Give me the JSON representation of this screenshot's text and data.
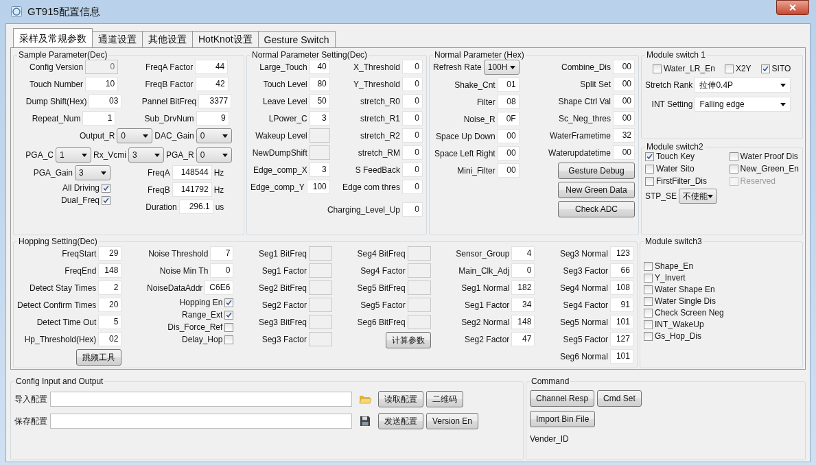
{
  "window": {
    "title": "GT915配置信息"
  },
  "tabs": [
    {
      "label": "采样及常规参数",
      "selected": true
    },
    {
      "label": "通道设置",
      "selected": false
    },
    {
      "label": "其他设置",
      "selected": false
    },
    {
      "label": "HotKnot设置",
      "selected": false
    },
    {
      "label": "Gesture Switch",
      "selected": false
    }
  ],
  "top_row": [
    {
      "title": "Sample Parameter(Dec)",
      "blocks": [
        {
          "columns": [
            [
              [
                {
                  "kind": "field",
                  "label": "Config Version",
                  "value": "0",
                  "disabled": true
                }
              ],
              [
                {
                  "kind": "field",
                  "label": "Touch Number",
                  "value": "10"
                }
              ],
              [
                {
                  "kind": "field",
                  "label": "Dump Shift(Hex)",
                  "value": "03"
                }
              ],
              [
                {
                  "kind": "field",
                  "label": "Repeat_Num",
                  "value": "1"
                }
              ]
            ],
            [
              [
                {
                  "kind": "field",
                  "label": "FreqA Factor",
                  "value": "44"
                }
              ],
              [
                {
                  "kind": "field",
                  "label": "FreqB Factor",
                  "value": "42"
                }
              ],
              [
                {
                  "kind": "field",
                  "label": "Pannel BitFreq",
                  "value": "3377"
                }
              ],
              [
                {
                  "kind": "field",
                  "label": "Sub_DrvNum",
                  "value": "9"
                }
              ]
            ]
          ]
        },
        {
          "columns": [
            [
              [
                {
                  "kind": "select",
                  "label": "Output_R",
                  "value": "0"
                },
                {
                  "kind": "select",
                  "label": "DAC_Gain",
                  "value": "0"
                }
              ],
              [
                {
                  "kind": "select",
                  "label": "PGA_C",
                  "value": "1"
                },
                {
                  "kind": "select",
                  "label": "Rx_Vcmi",
                  "value": "3"
                },
                {
                  "kind": "select",
                  "label": "PGA_R",
                  "value": "0"
                }
              ]
            ]
          ]
        },
        {
          "columns": [
            [
              [
                {
                  "kind": "select",
                  "label": "PGA_Gain",
                  "value": "3"
                }
              ],
              [
                {
                  "kind": "toggle",
                  "label": "All Driving",
                  "checked": true
                }
              ],
              [
                {
                  "kind": "toggle",
                  "label": "Dual_Freq",
                  "checked": true
                }
              ]
            ],
            [
              [
                {
                  "kind": "field",
                  "label": "FreqA",
                  "value": "148544",
                  "unit": "Hz"
                }
              ],
              [
                {
                  "kind": "field",
                  "label": "FreqB",
                  "value": "141792",
                  "unit": "Hz"
                }
              ],
              [
                {
                  "kind": "field",
                  "label": "Duration",
                  "value": "296.1",
                  "unit": "us"
                }
              ]
            ]
          ]
        }
      ]
    },
    {
      "title": "Normal Parameter Setting(Dec)",
      "blocks": [
        {
          "columns": [
            [
              [
                {
                  "kind": "field",
                  "label": "Large_Touch",
                  "value": "40"
                }
              ],
              [
                {
                  "kind": "field",
                  "label": "Touch Level",
                  "value": "80"
                }
              ],
              [
                {
                  "kind": "field",
                  "label": "Leave Level",
                  "value": "50"
                }
              ],
              [
                {
                  "kind": "field",
                  "label": "LPower_C",
                  "value": "3"
                }
              ],
              [
                {
                  "kind": "field",
                  "label": "Wakeup Level",
                  "disabled": true
                }
              ],
              [
                {
                  "kind": "field",
                  "label": "NewDumpShift",
                  "disabled": true
                }
              ],
              [
                {
                  "kind": "field",
                  "label": "Edge_comp_X",
                  "value": "3"
                }
              ],
              [
                {
                  "kind": "field",
                  "label": "Edge_comp_Y",
                  "value": "100"
                }
              ]
            ],
            [
              [
                {
                  "kind": "field",
                  "label": "X_Threshold",
                  "value": "0"
                }
              ],
              [
                {
                  "kind": "field",
                  "label": "Y_Threshold",
                  "value": "0"
                }
              ],
              [
                {
                  "kind": "field",
                  "label": "stretch_R0",
                  "value": "0"
                }
              ],
              [
                {
                  "kind": "field",
                  "label": "stretch_R1",
                  "value": "0"
                }
              ],
              [
                {
                  "kind": "field",
                  "label": "stretch_R2",
                  "value": "0"
                }
              ],
              [
                {
                  "kind": "field",
                  "label": "stretch_RM",
                  "value": "0"
                }
              ],
              [
                {
                  "kind": "field",
                  "label": "S  FeedBack",
                  "value": "0"
                }
              ],
              [
                {
                  "kind": "field",
                  "label": "Edge com thres",
                  "value": "0"
                }
              ]
            ]
          ]
        },
        {
          "columns": [
            [
              [
                {
                  "kind": "field",
                  "label": "Charging_Level_Up",
                  "value": "0"
                }
              ]
            ]
          ]
        }
      ]
    },
    {
      "title": "Normal Parameter (Hex)",
      "blocks": [
        {
          "columns": [
            [
              [
                {
                  "kind": "select",
                  "label": "Refresh Rate",
                  "value": "100H"
                }
              ],
              [
                {
                  "kind": "field",
                  "label": "Shake_Cnt",
                  "value": "01"
                }
              ],
              [
                {
                  "kind": "field",
                  "label": "Filter",
                  "value": "08"
                }
              ],
              [
                {
                  "kind": "field",
                  "label": "Noise_R",
                  "value": "0F"
                }
              ],
              [
                {
                  "kind": "field",
                  "label": "Space Up Down",
                  "value": "00"
                }
              ],
              [
                {
                  "kind": "field",
                  "label": "Space Left Right",
                  "value": "00"
                }
              ],
              [
                {
                  "kind": "field",
                  "label": "Mini_Filter",
                  "value": "00"
                }
              ]
            ],
            [
              [
                {
                  "kind": "field",
                  "label": "Combine_Dis",
                  "value": "00"
                }
              ],
              [
                {
                  "kind": "field",
                  "label": "Split Set",
                  "value": "00"
                }
              ],
              [
                {
                  "kind": "field",
                  "label": "Shape Ctrl Val",
                  "value": "00"
                }
              ],
              [
                {
                  "kind": "field",
                  "label": "Sc_Neg_thres",
                  "value": "00"
                }
              ],
              [
                {
                  "kind": "field",
                  "label": "WaterFrametime",
                  "value": "32"
                }
              ],
              [
                {
                  "kind": "field",
                  "label": "Waterupdatetime",
                  "value": "00"
                }
              ],
              [
                {
                  "kind": "button",
                  "label": "Gesture Debug"
                }
              ],
              [
                {
                  "kind": "button",
                  "label": "New Green Data"
                }
              ],
              [
                {
                  "kind": "button",
                  "label": "Check ADC"
                }
              ]
            ]
          ]
        }
      ]
    }
  ],
  "side_stack": [
    {
      "title": "Module switch 1",
      "blocks": [
        {
          "columns": [
            [
              [
                {
                  "kind": "check",
                  "label": "Water_LR_En",
                  "checked": false
                },
                {
                  "kind": "check",
                  "label": "X2Y",
                  "checked": false
                },
                {
                  "kind": "check",
                  "label": "SITO",
                  "checked": true
                }
              ],
              [
                {
                  "kind": "combo",
                  "label": "Stretch Rank",
                  "value": "拉伸0.4P"
                }
              ],
              [
                {
                  "kind": "combo",
                  "label": "INT Setting",
                  "value": "Falling edge"
                }
              ]
            ]
          ]
        }
      ]
    },
    {
      "title": "Module switch2",
      "blocks": [
        {
          "columns": [
            [
              [
                {
                  "kind": "check",
                  "label": "Touch Key",
                  "checked": true
                }
              ],
              [
                {
                  "kind": "check",
                  "label": "Water Sito",
                  "checked": false
                }
              ],
              [
                {
                  "kind": "check",
                  "label": "FirstFilter_Dis",
                  "checked": false
                }
              ]
            ],
            [
              [
                {
                  "kind": "check",
                  "label": "Water Proof Dis",
                  "checked": false
                }
              ],
              [
                {
                  "kind": "check",
                  "label": "New_Green_En",
                  "checked": false
                }
              ],
              [
                {
                  "kind": "check",
                  "label": "Reserved",
                  "checked": false,
                  "disabled": true
                }
              ]
            ]
          ]
        },
        {
          "columns": [
            [
              [
                {
                  "kind": "select",
                  "label": "STP_SE",
                  "value": "不使能"
                }
              ]
            ]
          ]
        }
      ]
    }
  ],
  "bottom_row": [
    {
      "title": "Hopping Setting(Dec)",
      "blocks": [
        {
          "columns": [
            [
              [
                {
                  "kind": "field",
                  "label": "FreqStart",
                  "value": "29"
                }
              ],
              [
                {
                  "kind": "field",
                  "label": "FreqEnd",
                  "value": "148"
                }
              ],
              [
                {
                  "kind": "field",
                  "label": "Detect Stay Times",
                  "value": "2"
                }
              ],
              [
                {
                  "kind": "field",
                  "label": "Detect Confirm Times",
                  "value": "20"
                }
              ],
              [
                {
                  "kind": "field",
                  "label": "Detect Time Out",
                  "value": "5"
                }
              ],
              [
                {
                  "kind": "field",
                  "label": "Hp_Threshold(Hex)",
                  "value": "02"
                }
              ],
              [
                {
                  "kind": "button",
                  "label": "跳频工具"
                }
              ]
            ],
            [
              [
                {
                  "kind": "field",
                  "label": "Noise Threshold",
                  "value": "7"
                }
              ],
              [
                {
                  "kind": "field",
                  "label": "Noise Min Th",
                  "value": "0"
                }
              ],
              [
                {
                  "kind": "field",
                  "label": "NoiseDataAddr",
                  "value": "C6E6"
                }
              ],
              [
                {
                  "kind": "toggle",
                  "label": "Hopping En",
                  "checked": true
                }
              ],
              [
                {
                  "kind": "toggle",
                  "label": "Range_Ext",
                  "checked": true
                }
              ],
              [
                {
                  "kind": "toggle",
                  "label": "Dis_Force_Ref",
                  "checked": false
                }
              ],
              [
                {
                  "kind": "toggle",
                  "label": "Delay_Hop",
                  "checked": false
                }
              ]
            ],
            [
              [
                {
                  "kind": "field",
                  "label": "Seg1 BitFreq",
                  "disabled": true
                }
              ],
              [
                {
                  "kind": "field",
                  "label": "Seg1 Factor",
                  "disabled": true
                }
              ],
              [
                {
                  "kind": "field",
                  "label": "Seg2 BitFreq",
                  "disabled": true
                }
              ],
              [
                {
                  "kind": "field",
                  "label": "Seg2 Factor",
                  "disabled": true
                }
              ],
              [
                {
                  "kind": "field",
                  "label": "Seg3 BitFreq",
                  "disabled": true
                }
              ],
              [
                {
                  "kind": "field",
                  "label": "Seg3 Factor",
                  "disabled": true
                }
              ]
            ],
            [
              [
                {
                  "kind": "field",
                  "label": "Seg4 BitFreq",
                  "disabled": true
                }
              ],
              [
                {
                  "kind": "field",
                  "label": "Seg4 Factor",
                  "disabled": true
                }
              ],
              [
                {
                  "kind": "field",
                  "label": "Seg5 BitFreq",
                  "disabled": true
                }
              ],
              [
                {
                  "kind": "field",
                  "label": "Seg5 Factor",
                  "disabled": true
                }
              ],
              [
                {
                  "kind": "field",
                  "label": "Seg6 BitFreq",
                  "disabled": true
                }
              ],
              [
                {
                  "kind": "button",
                  "label": "计算参数"
                }
              ]
            ],
            [
              [
                {
                  "kind": "field",
                  "label": "Sensor_Group",
                  "value": "4"
                }
              ],
              [
                {
                  "kind": "field",
                  "label": "Main_Clk_Adj",
                  "value": "0"
                }
              ],
              [
                {
                  "kind": "field",
                  "label": "Seg1 Normal",
                  "value": "182"
                }
              ],
              [
                {
                  "kind": "field",
                  "label": "Seg1 Factor",
                  "value": "34"
                }
              ],
              [
                {
                  "kind": "field",
                  "label": "Seg2 Normal",
                  "value": "148"
                }
              ],
              [
                {
                  "kind": "field",
                  "label": "Seg2 Factor",
                  "value": "47"
                }
              ]
            ],
            [
              [
                {
                  "kind": "field",
                  "label": "Seg3 Normal",
                  "value": "123"
                }
              ],
              [
                {
                  "kind": "field",
                  "label": "Seg3 Factor",
                  "value": "66"
                }
              ],
              [
                {
                  "kind": "field",
                  "label": "Seg4 Normal",
                  "value": "108"
                }
              ],
              [
                {
                  "kind": "field",
                  "label": "Seg4 Factor",
                  "value": "91"
                }
              ],
              [
                {
                  "kind": "field",
                  "label": "Seg5 Normal",
                  "value": "101"
                }
              ],
              [
                {
                  "kind": "field",
                  "label": "Seg5 Factor",
                  "value": "127"
                }
              ],
              [
                {
                  "kind": "field",
                  "label": "Seg6 Normal",
                  "value": "101"
                }
              ]
            ]
          ]
        }
      ]
    },
    {
      "title": "Module switch3",
      "blocks": [
        {
          "columns": [
            [
              [
                {
                  "kind": "check",
                  "label": "Shape_En",
                  "checked": false
                }
              ],
              [
                {
                  "kind": "check",
                  "label": "Y_Invert",
                  "checked": false
                }
              ],
              [
                {
                  "kind": "check",
                  "label": "Water Shape En",
                  "checked": false
                }
              ],
              [
                {
                  "kind": "check",
                  "label": "Water Single Dis",
                  "checked": false
                }
              ],
              [
                {
                  "kind": "check",
                  "label": "Check Screen Neg",
                  "checked": false
                }
              ],
              [
                {
                  "kind": "check",
                  "label": "INT_WakeUp",
                  "checked": false
                }
              ],
              [
                {
                  "kind": "check",
                  "label": "Gs_Hop_Dis",
                  "checked": false
                }
              ]
            ]
          ]
        }
      ]
    }
  ],
  "config_io": {
    "title": "Config Input and Output",
    "rows": [
      [
        {
          "kind": "open_path",
          "label": "导入配置"
        },
        {
          "kind": "button",
          "label": "读取配置"
        },
        {
          "kind": "button",
          "label": "二维码"
        }
      ],
      [
        {
          "kind": "save_path",
          "label": "保存配置"
        },
        {
          "kind": "button",
          "label": "发送配置"
        },
        {
          "kind": "button",
          "label": "Version En"
        }
      ]
    ]
  },
  "command": {
    "title": "Command",
    "rows": [
      [
        {
          "kind": "button",
          "label": "Channel Resp"
        },
        {
          "kind": "button",
          "label": "Cmd Set"
        }
      ],
      [
        {
          "kind": "button",
          "label": "Import Bin File"
        }
      ],
      [
        {
          "kind": "text",
          "label": "Vender_ID"
        }
      ]
    ]
  }
}
